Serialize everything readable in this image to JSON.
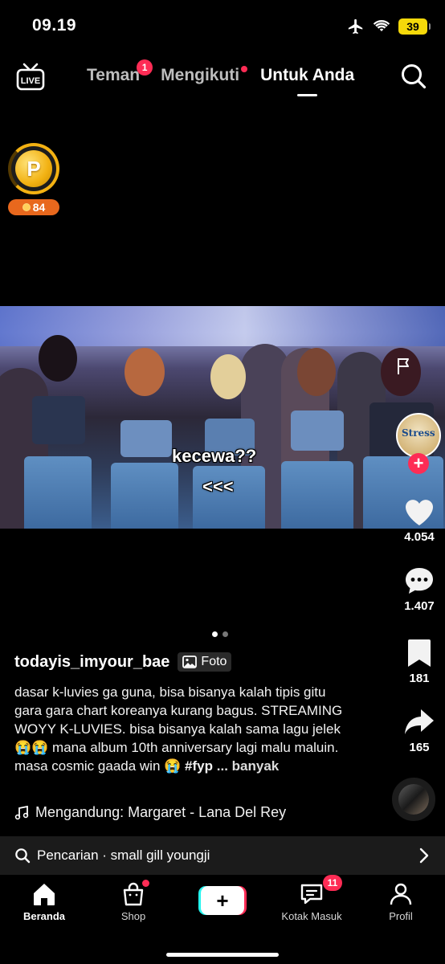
{
  "status_bar": {
    "time": "09.19",
    "battery": "39"
  },
  "top_nav": {
    "tabs": [
      {
        "label": "Teman",
        "badge": "1"
      },
      {
        "label": "Mengikuti"
      },
      {
        "label": "Untuk Anda"
      }
    ]
  },
  "coin_widget": {
    "count": "84"
  },
  "photo": {
    "caption_1": "kecewa??",
    "caption_2": "<<<"
  },
  "rail": {
    "likes": "4.054",
    "comments": "1.407",
    "saves": "181",
    "shares": "165",
    "avatar_text": "Stress"
  },
  "post": {
    "author": "todayis_imyour_bae",
    "type_badge": "Foto",
    "description": "dasar k-luvies ga guna, bisa bisanya kalah tipis gitu gara gara chart koreanya kurang bagus. STREAMING WOYY K-LUVIES. bisa bisanya kalah sama lagu jelek 😭😭 mana album 10th anniversary lagi malu maluin. masa cosmic gaada win 😭",
    "hashtag": "#fyp",
    "more_label": "... banyak",
    "music": "Mengandung: Margaret - Lana Del Rey"
  },
  "search_suggestion": {
    "prefix": "Pencarian",
    "separator": " · ",
    "query": "small gill youngji"
  },
  "bottom_nav": {
    "items": [
      {
        "label": "Beranda"
      },
      {
        "label": "Shop"
      },
      {
        "label": "Kotak Masuk",
        "badge": "11"
      },
      {
        "label": "Profil"
      }
    ]
  },
  "colors": {
    "accent": "#fe2c55",
    "cyan": "#25f4ee",
    "coin": "#f3b112",
    "coin_badge": "#e8681d"
  }
}
